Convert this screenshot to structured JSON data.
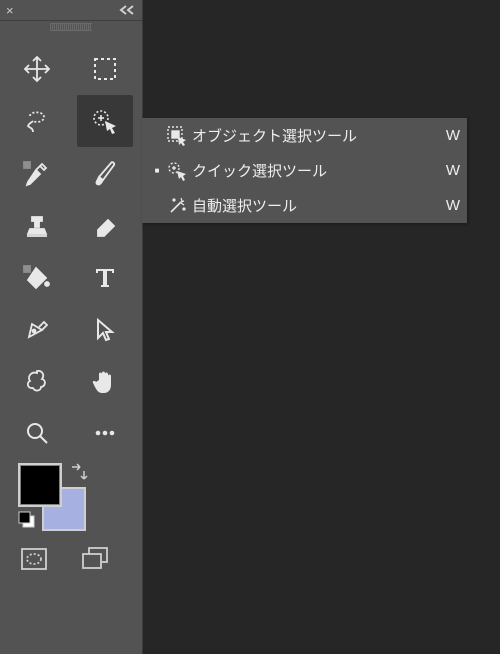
{
  "panel": {
    "close_label": "×"
  },
  "tools": {
    "row0": {
      "left": "move-tool",
      "right": "marquee-tool"
    },
    "row1": {
      "left": "lasso-tool",
      "right": "quick-selection-tool"
    },
    "row2": {
      "left": "eyedropper-tool",
      "right": "brush-tool"
    },
    "row3": {
      "left": "clone-stamp-tool",
      "right": "eraser-tool"
    },
    "row4": {
      "left": "paint-bucket-tool",
      "right": "type-tool"
    },
    "row5": {
      "left": "pen-tool",
      "right": "direct-selection-tool"
    },
    "row6": {
      "left": "shape-tool",
      "right": "hand-tool"
    },
    "row7": {
      "left": "zoom-tool",
      "right": "more-tools"
    }
  },
  "colors": {
    "foreground": "#000000",
    "background": "#a6b1e1"
  },
  "flyout": {
    "items": [
      {
        "label": "オブジェクト選択ツール",
        "shortcut": "W",
        "checked": false,
        "icon": "object-selection"
      },
      {
        "label": "クイック選択ツール",
        "shortcut": "W",
        "checked": true,
        "icon": "quick-selection"
      },
      {
        "label": "自動選択ツール",
        "shortcut": "W",
        "checked": false,
        "icon": "magic-wand"
      }
    ]
  }
}
